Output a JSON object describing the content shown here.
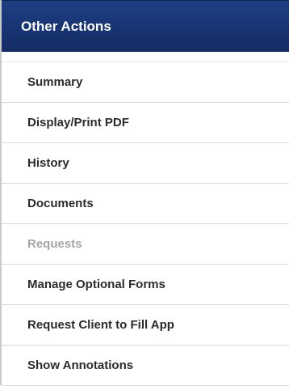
{
  "panel": {
    "title": "Other Actions",
    "header_color": "#183473",
    "items": [
      {
        "label": "Summary",
        "enabled": true
      },
      {
        "label": "Display/Print PDF",
        "enabled": true
      },
      {
        "label": "History",
        "enabled": true
      },
      {
        "label": "Documents",
        "enabled": true
      },
      {
        "label": "Requests",
        "enabled": false
      },
      {
        "label": "Manage Optional Forms",
        "enabled": true
      },
      {
        "label": "Request Client to Fill App",
        "enabled": true
      },
      {
        "label": "Show Annotations",
        "enabled": true
      }
    ]
  }
}
